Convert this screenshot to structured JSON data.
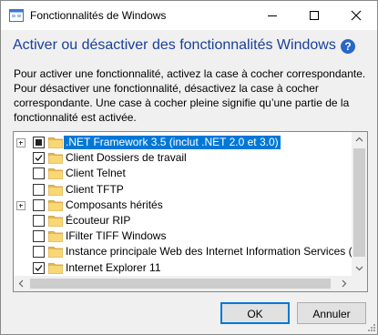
{
  "window": {
    "title": "Fonctionnalités de Windows"
  },
  "heading": "Activer ou désactiver des fonctionnalités Windows",
  "help_label": "?",
  "description": [
    "Pour activer une fonctionnalité, activez la case à cocher correspondante.",
    "Pour désactiver une fonctionnalité, désactivez la case à cocher",
    "correspondante. Une case à cocher pleine signifie qu’une partie de la",
    "fonctionnalité est activée."
  ],
  "features": [
    {
      "label": ".NET Framework 3.5 (inclut .NET 2.0 et 3.0)",
      "state": "partial",
      "expandable": true,
      "selected": true
    },
    {
      "label": "Client Dossiers de travail",
      "state": "checked",
      "expandable": false,
      "selected": false
    },
    {
      "label": "Client Telnet",
      "state": "unchecked",
      "expandable": false,
      "selected": false
    },
    {
      "label": "Client TFTP",
      "state": "unchecked",
      "expandable": false,
      "selected": false
    },
    {
      "label": "Composants hérités",
      "state": "unchecked",
      "expandable": true,
      "selected": false
    },
    {
      "label": "Écouteur RIP",
      "state": "unchecked",
      "expandable": false,
      "selected": false
    },
    {
      "label": "IFilter TIFF Windows",
      "state": "unchecked",
      "expandable": false,
      "selected": false
    },
    {
      "label": "Instance principale Web des Internet Information Services (IIS",
      "state": "unchecked",
      "expandable": false,
      "selected": false
    },
    {
      "label": "Internet Explorer 11",
      "state": "checked",
      "expandable": false,
      "selected": false
    }
  ],
  "buttons": {
    "ok": "OK",
    "cancel": "Annuler"
  },
  "colors": {
    "accent": "#0078d7",
    "heading": "#1a3f9a",
    "folder": "#f8d775",
    "help": "#2966c8"
  }
}
